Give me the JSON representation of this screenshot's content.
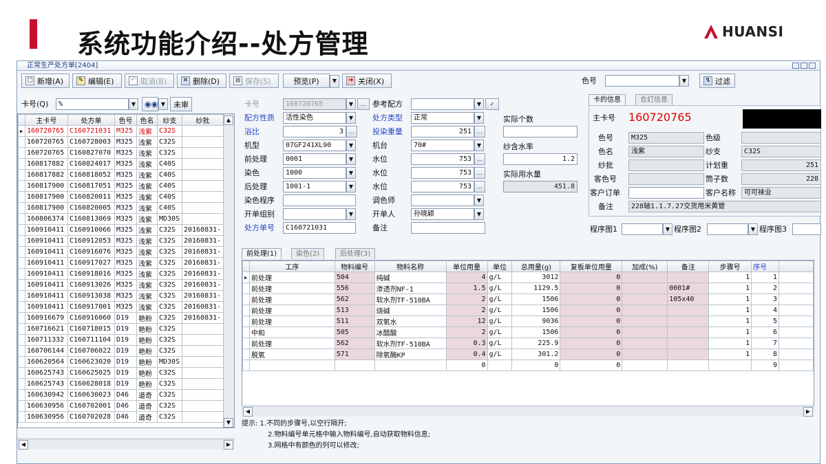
{
  "slide": {
    "title": "系统功能介绍--处方管理",
    "logo_text": "HUANSI",
    "accent": "#c8102e"
  },
  "window": {
    "title": "正常生产处方单[2404]"
  },
  "toolbar": {
    "new": "新增(A)",
    "edit": "编辑(E)",
    "cancel": "取消(B)",
    "delete": "删除(D)",
    "save": "保存(S)",
    "preview": "预览(P)",
    "close": "关闭(X)",
    "color_label": "色号",
    "filter": "过滤"
  },
  "search": {
    "label": "卡号(Q)",
    "value": "%",
    "unreviewed": "未审"
  },
  "left_grid": {
    "headers": [
      "主卡号",
      "处方单",
      "色号",
      "色名",
      "纱支",
      "纱批"
    ],
    "rows": [
      [
        "160720765",
        "C160721031",
        "M325",
        "浅紫",
        "C32S",
        ""
      ],
      [
        "160720765",
        "C160728003",
        "M325",
        "浅紫",
        "C32S",
        ""
      ],
      [
        "160720765",
        "C160827070",
        "M325",
        "浅紫",
        "C32S",
        ""
      ],
      [
        "160817882",
        "C160824017",
        "M325",
        "浅紫",
        "C40S",
        ""
      ],
      [
        "160817882",
        "C160818052",
        "M325",
        "浅紫",
        "C40S",
        ""
      ],
      [
        "160817900",
        "C160817051",
        "M325",
        "浅紫",
        "C40S",
        ""
      ],
      [
        "160817900",
        "C160820011",
        "M325",
        "浅紫",
        "C40S",
        ""
      ],
      [
        "160817900",
        "C160820005",
        "M325",
        "浅紫",
        "C40S",
        ""
      ],
      [
        "160806374",
        "C160813069",
        "M325",
        "浅紫",
        "MD30S",
        ""
      ],
      [
        "160910411",
        "C160910066",
        "M325",
        "浅紫",
        "C32S",
        "20160831-"
      ],
      [
        "160910411",
        "C160912053",
        "M325",
        "浅紫",
        "C32S",
        "20160831-"
      ],
      [
        "160910411",
        "C160916076",
        "M325",
        "浅紫",
        "C32S",
        "20160831-"
      ],
      [
        "160910411",
        "C160917027",
        "M325",
        "浅紫",
        "C32S",
        "20160831-"
      ],
      [
        "160910411",
        "C160918016",
        "M325",
        "浅紫",
        "C32S",
        "20160831-"
      ],
      [
        "160910411",
        "C160913026",
        "M325",
        "浅紫",
        "C32S",
        "20160831-"
      ],
      [
        "160910411",
        "C160913038",
        "M325",
        "浅紫",
        "C32S",
        "20160831-"
      ],
      [
        "160910411",
        "C160917001",
        "M325",
        "浅紫",
        "C32S",
        "20160831-"
      ],
      [
        "160916679",
        "C160916060",
        "D19",
        "艳粉",
        "C32S",
        "20160831-"
      ],
      [
        "160716621",
        "C160718015",
        "D19",
        "艳粉",
        "C32S",
        ""
      ],
      [
        "160711332",
        "C160711104",
        "D19",
        "艳粉",
        "C32S",
        ""
      ],
      [
        "160706144",
        "C160706022",
        "D19",
        "艳粉",
        "C32S",
        ""
      ],
      [
        "160620564",
        "C160623020",
        "D19",
        "艳粉",
        "MD30S",
        ""
      ],
      [
        "160625743",
        "C160625025",
        "D19",
        "艳粉",
        "C32S",
        ""
      ],
      [
        "160625743",
        "C160628018",
        "D19",
        "艳粉",
        "C32S",
        ""
      ],
      [
        "160630942",
        "C160630023",
        "D46",
        "道奇",
        "C32S",
        ""
      ],
      [
        "160630956",
        "C160702001",
        "D46",
        "道奇",
        "C32S",
        ""
      ],
      [
        "160630956",
        "C160702028",
        "D46",
        "道奇",
        "C32S",
        ""
      ]
    ]
  },
  "form": {
    "card_no_label": "卡号",
    "card_no": "160720765",
    "ref_recipe_label": "参考配方",
    "recipe_nature_label": "配方性质",
    "recipe_nature": "活性染色",
    "recipe_type_label": "处方类型",
    "recipe_type": "正常",
    "bath_ratio_label": "浴比",
    "bath_ratio": "3",
    "feed_weight_label": "投染重量",
    "feed_weight": "251",
    "machine_type_label": "机型",
    "machine_type": "07GF241XL90",
    "machine_label": "机台",
    "machine": "70#",
    "pretreat_label": "前处理",
    "pretreat": "0001",
    "water1_label": "水位",
    "water1": "753",
    "dye_label": "染色",
    "dye": "1000",
    "water2_label": "水位",
    "water2": "753",
    "posttreat_label": "后处理",
    "posttreat": "1001-1",
    "water3_label": "水位",
    "water3": "753",
    "dye_program_label": "染色程序",
    "dyer_label": "调色师",
    "group_label": "开单组别",
    "issuer_label": "开单人",
    "issuer": "孙晓颖",
    "recipe_no_label": "处方单号",
    "recipe_no": "C160721031",
    "remark_label": "备注",
    "actual_count_label": "实际个数",
    "moisture_label": "纱含水率",
    "moisture": "1.2",
    "actual_water_label": "实际用水量",
    "actual_water": "451.8"
  },
  "card_info": {
    "tab1": "卡的信息",
    "tab2": "合訂信息",
    "main_card_label": "主卡号",
    "main_card": "160720765",
    "color_no_label": "色号",
    "color_no": "M325",
    "grade_label": "色级",
    "color_name_label": "色名",
    "color_name": "浅紫",
    "yarn_label": "纱支",
    "yarn": "C32S",
    "yarn_batch_label": "纱批",
    "plan_weight_label": "计划重",
    "plan_weight": "251",
    "guest_color_label": "客色号",
    "tube_count_label": "筒子数",
    "tube_count": "228",
    "customer_order_label": "客户订单",
    "customer_name_label": "客户名称",
    "customer_name": "可可袜业",
    "note_label": "备注",
    "note": "228轴1.1.7.27交货用米黄管"
  },
  "program": {
    "p1": "程序图1",
    "p2": "程序图2",
    "p3": "程序图3"
  },
  "tabs": [
    "前处理(1)",
    "染色(2)",
    "后处理(3)"
  ],
  "detail_grid": {
    "headers": [
      "工序",
      "物料编号",
      "物料名称",
      "单位用量",
      "单位",
      "总用量(g)",
      "复板单位用量",
      "加成(%)",
      "备注",
      "步骤号",
      "序号"
    ],
    "rows": [
      [
        "前处理",
        "504",
        "纯碱",
        "4",
        "g/L",
        "3012",
        "0",
        "",
        "",
        "1",
        "1"
      ],
      [
        "前处理",
        "556",
        "渗透剂NF-1",
        "1.5",
        "g/L",
        "1129.5",
        "0",
        "",
        "0001#",
        "1",
        "2"
      ],
      [
        "前处理",
        "562",
        "软水剂TF-510BA",
        "2",
        "g/L",
        "1506",
        "0",
        "",
        "105x40",
        "1",
        "3"
      ],
      [
        "前处理",
        "513",
        "烧碱",
        "2",
        "g/L",
        "1506",
        "0",
        "",
        "",
        "1",
        "4"
      ],
      [
        "前处理",
        "511",
        "双氧水",
        "12",
        "g/L",
        "9036",
        "0",
        "",
        "",
        "1",
        "5"
      ],
      [
        "中和",
        "505",
        "冰醋酸",
        "2",
        "g/L",
        "1506",
        "0",
        "",
        "",
        "1",
        "6"
      ],
      [
        "前处理",
        "562",
        "软水剂TF-510BA",
        "0.3",
        "g/L",
        "225.9",
        "0",
        "",
        "",
        "1",
        "7"
      ],
      [
        "脱氧",
        "571",
        "除氧酶KP",
        "0.4",
        "g/L",
        "301.2",
        "0",
        "",
        "",
        "1",
        "8"
      ],
      [
        "",
        "",
        "",
        "0",
        "",
        "0",
        "0",
        "",
        "",
        "",
        "9"
      ]
    ]
  },
  "hints": [
    "提示: 1.不同的步骤号,以空行隔开;",
    "2.物料编号单元格中输入物料编号,自动获取物料信息;",
    "3.网格中有颜色的列可以修改;"
  ]
}
